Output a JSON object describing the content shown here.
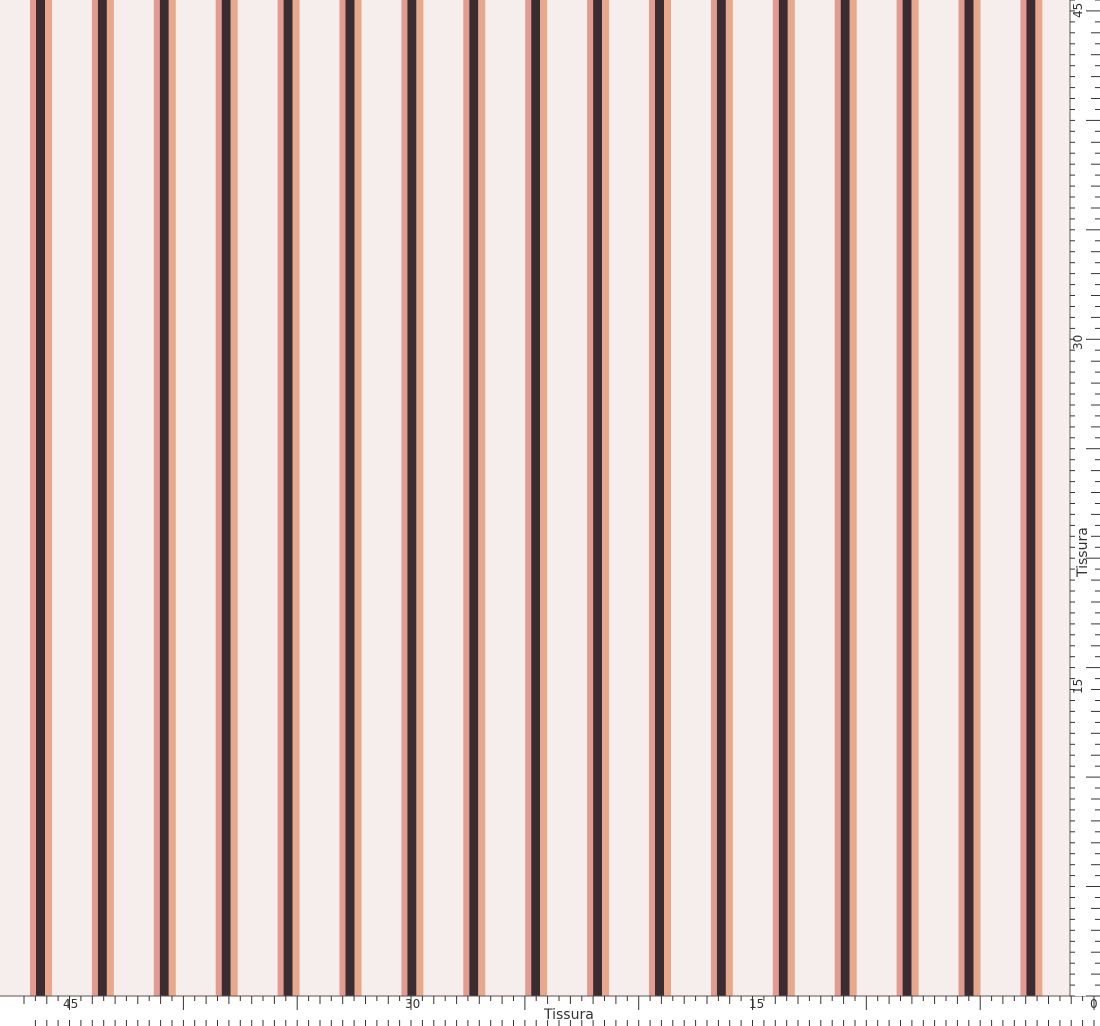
{
  "colors": {
    "background": "#f6eeec",
    "dark_stripe": "#3a2c31",
    "peach_stripe": "#e8a88c",
    "rose_stripe": "#e39b8f",
    "ruler_bg": "#ffffff",
    "ruler_ink": "#333333"
  },
  "ruler_bottom": {
    "label": "Tissura",
    "ticks": [
      "45",
      "30",
      "15",
      "0"
    ]
  },
  "ruler_right": {
    "label": "Tissura",
    "ticks": [
      "45",
      "30",
      "15"
    ]
  },
  "stripe_count": 17
}
